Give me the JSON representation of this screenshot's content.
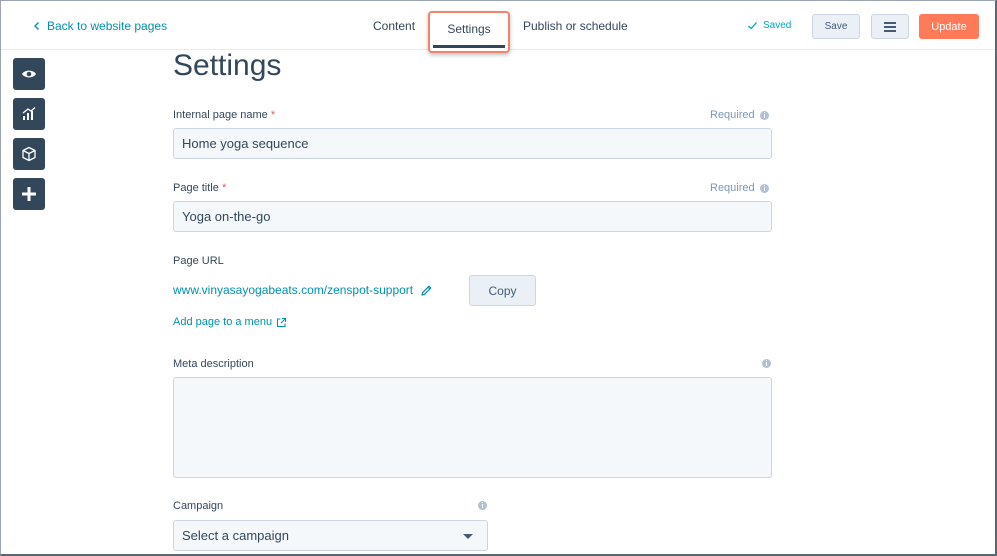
{
  "topbar": {
    "back_label": "Back to website pages",
    "tabs": [
      {
        "label": "Content"
      },
      {
        "label": "Settings"
      },
      {
        "label": "Publish or schedule"
      }
    ],
    "saved_label": "Saved",
    "save_label": "Save",
    "update_label": "Update"
  },
  "rail": {
    "icons": [
      "eye-icon",
      "chart-icon",
      "cube-icon",
      "plus-icon"
    ]
  },
  "form": {
    "title": "Settings",
    "internal_name": {
      "label": "Internal page name",
      "required_mark": "*",
      "required_note": "Required",
      "value": "Home yoga sequence"
    },
    "page_title": {
      "label": "Page title",
      "required_mark": "*",
      "required_note": "Required",
      "value": "Yoga on-the-go"
    },
    "page_url": {
      "label": "Page URL",
      "value": "www.vinyasayogabeats.com/zenspot-support",
      "copy_label": "Copy",
      "add_menu_label": "Add page to a menu"
    },
    "meta": {
      "label": "Meta description",
      "value": ""
    },
    "campaign": {
      "label": "Campaign",
      "selected": "Select a campaign"
    }
  },
  "colors": {
    "accent": "#0091ae",
    "update": "#ff7a59",
    "highlight": "#f2846a",
    "rail": "#33475b"
  }
}
